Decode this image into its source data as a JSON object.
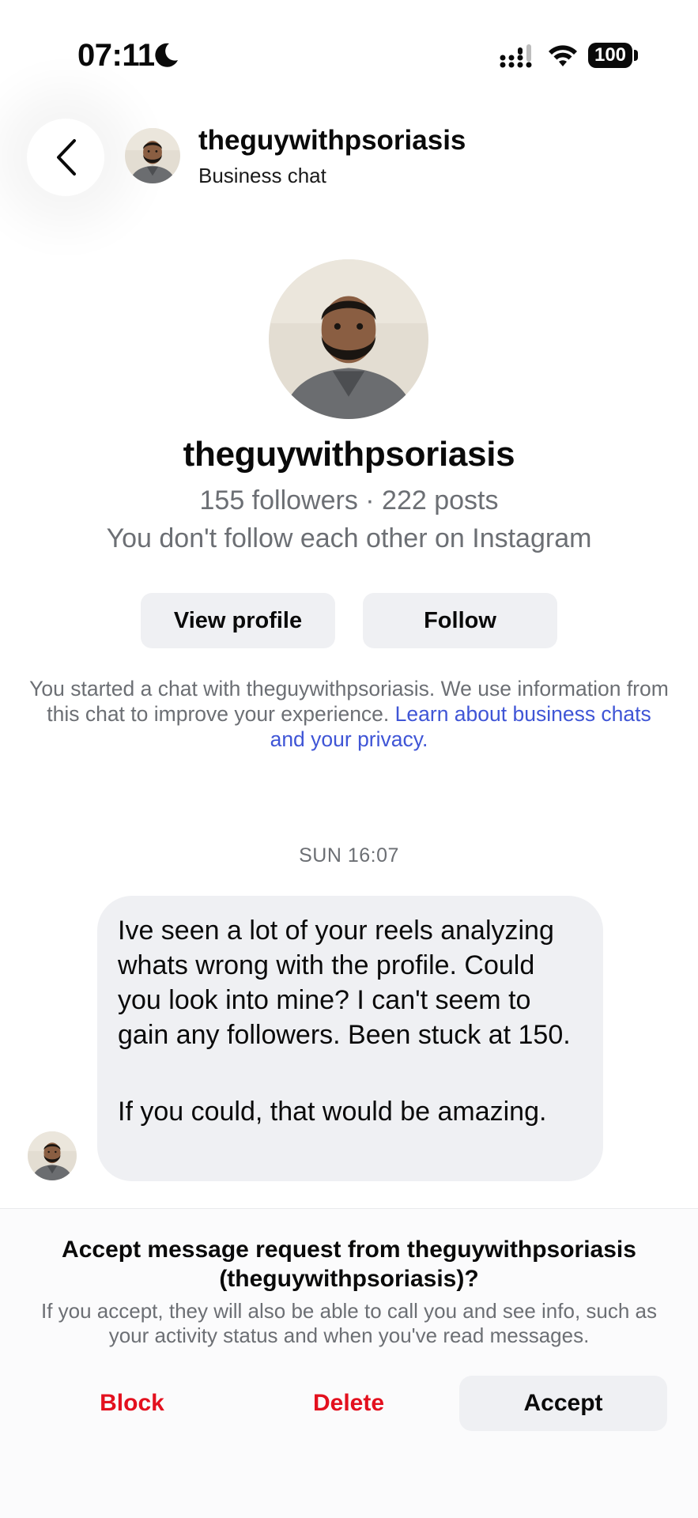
{
  "status_bar": {
    "time": "07:11",
    "battery": "100",
    "icons": [
      "moon-icon",
      "signal-icon",
      "wifi-icon",
      "battery-icon"
    ]
  },
  "header": {
    "back_icon": "chevron-left-icon",
    "username": "theguywithpsoriasis",
    "subtitle": "Business chat"
  },
  "profile": {
    "name": "theguywithpsoriasis",
    "stats": "155 followers · 222 posts",
    "relation": "You don't follow each other on Instagram",
    "view_profile_label": "View profile",
    "follow_label": "Follow"
  },
  "notice": {
    "text": "You started a chat with theguywithpsoriasis. We use information from this chat to improve your experience.",
    "link": "Learn about business chats and your privacy."
  },
  "conversation": {
    "timestamp": "SUN 16:07",
    "message_part1": "Ive seen a lot of your reels analyzing whats wrong with the profile. Could you look into mine? I can't seem to gain any followers. Been stuck at 150.",
    "message_part2": "If you could, that would be amazing."
  },
  "request": {
    "title": "Accept message request from theguywithpsoriasis (theguywithpsoriasis)?",
    "info": "If you accept, they will also be able to call you and see info, such as your activity status and when you've read messages.",
    "block_label": "Block",
    "delete_label": "Delete",
    "accept_label": "Accept"
  },
  "colors": {
    "link": "#3f55d6",
    "danger": "#e3101e",
    "button_bg": "#eff0f3",
    "muted_text": "#6c6f74"
  }
}
